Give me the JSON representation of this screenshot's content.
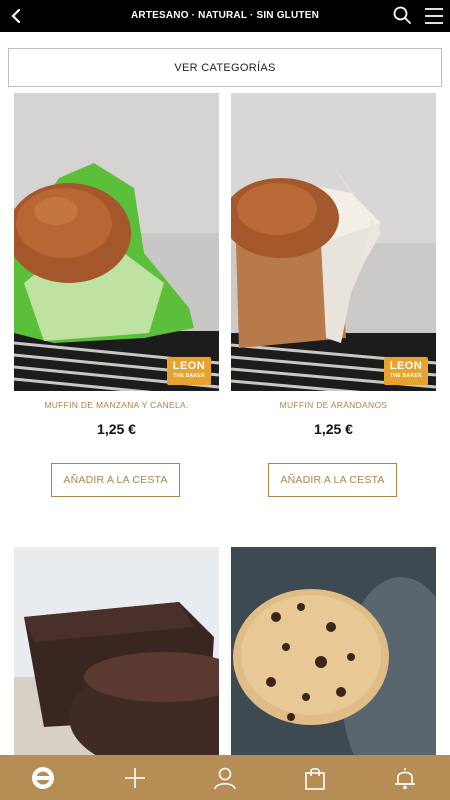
{
  "header": {
    "title": "ARTESANO · NATURAL · SIN GLUTEN",
    "icons": [
      "back-arrow-icon",
      "search-icon",
      "hamburger-menu-icon"
    ]
  },
  "categories_button": {
    "label": "VER CATEGORÍAS"
  },
  "products": [
    {
      "name": "MUFFIN DE MANZANA Y CANELA.",
      "price": "1,25 €",
      "add_label": "AÑADIR A LA CESTA",
      "badge": {
        "line1": "LEON",
        "line2": "THE BAKER"
      }
    },
    {
      "name": "MUFFIN DE ARÁNDANOS",
      "price": "1,25 €",
      "add_label": "AÑADIR A LA CESTA",
      "badge": {
        "line1": "LEON",
        "line2": "THE BAKER"
      }
    },
    {
      "name": "",
      "price": "",
      "add_label": ""
    },
    {
      "name": "",
      "price": "",
      "add_label": ""
    }
  ],
  "bottom_nav": {
    "items": [
      "home-logo-icon",
      "plus-icon",
      "user-icon",
      "shopping-bag-icon",
      "bell-icon"
    ]
  },
  "colors": {
    "topbar": "#000000",
    "accent_gold": "#a8854d",
    "bottom_nav": "#b68d55",
    "badge": "#e8a32e"
  }
}
